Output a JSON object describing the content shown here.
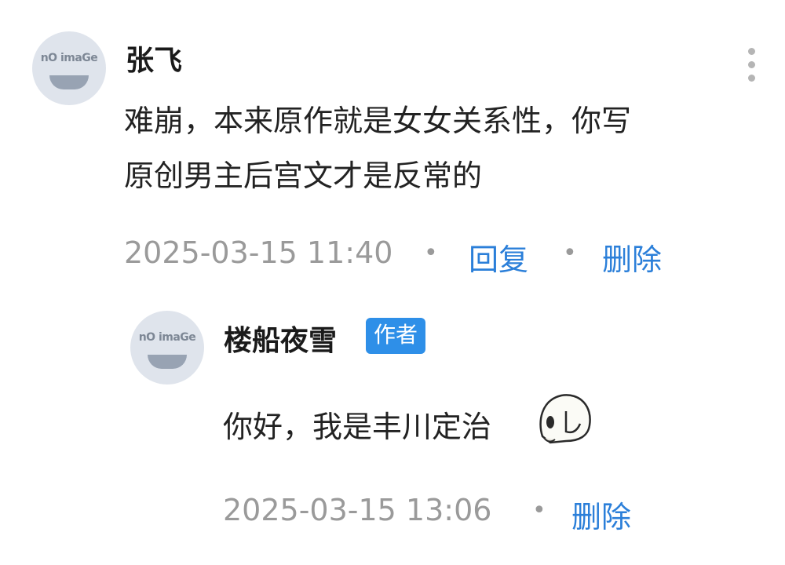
{
  "comment": {
    "avatar_text": "nO imaGe",
    "author": "张飞",
    "text_line1": "难崩，本来原作就是女女关系性，你写",
    "text_line2": "原创男主后宫文才是反常的",
    "timestamp": "2025-03-15 11:40",
    "separator": "•",
    "reply_label": "回复",
    "delete_label": "删除",
    "more_icon": "more-vertical-icon"
  },
  "reply": {
    "avatar_text": "nO imaGe",
    "author": "楼船夜雪",
    "author_badge": "作者",
    "text": "你好，我是丰川定治",
    "emoji": "meme-sticker-icon",
    "timestamp": "2025-03-15 13:06",
    "separator": "•",
    "delete_label": "删除"
  },
  "colors": {
    "link": "#2b7fd9",
    "badge": "#2e8fe8",
    "meta": "#9a9a9a"
  }
}
